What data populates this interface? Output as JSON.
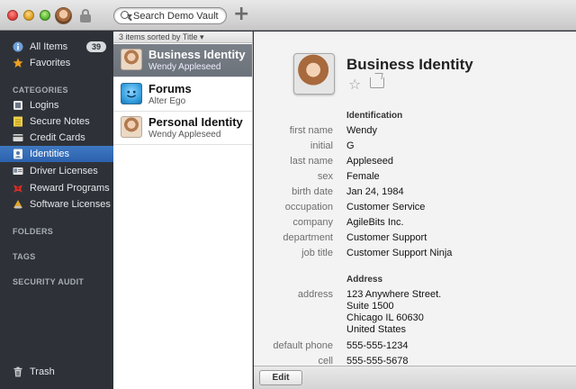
{
  "search": {
    "placeholder": "Search Demo Vault"
  },
  "sidebar": {
    "all_items": {
      "label": "All Items",
      "count": "39"
    },
    "favorites": "Favorites",
    "categories_heading": "CATEGORIES",
    "categories": [
      {
        "label": "Logins",
        "icon": "logins-icon"
      },
      {
        "label": "Secure Notes",
        "icon": "secure-notes-icon"
      },
      {
        "label": "Credit Cards",
        "icon": "credit-card-icon"
      },
      {
        "label": "Identities",
        "icon": "identity-icon",
        "selected": true
      },
      {
        "label": "Driver Licenses",
        "icon": "driver-license-icon"
      },
      {
        "label": "Reward Programs",
        "icon": "ribbon-icon"
      },
      {
        "label": "Software Licenses",
        "icon": "software-license-icon"
      }
    ],
    "folders_heading": "FOLDERS",
    "tags_heading": "TAGS",
    "security_audit_heading": "SECURITY AUDIT",
    "trash": "Trash"
  },
  "list": {
    "sort_header": "3 items sorted by Title ▾",
    "items": [
      {
        "title": "Business Identity",
        "subtitle": "Wendy Appleseed",
        "selected": true
      },
      {
        "title": "Forums",
        "subtitle": "Alter Ego"
      },
      {
        "title": "Personal Identity",
        "subtitle": "Wendy Appleseed"
      }
    ]
  },
  "detail": {
    "title": "Business Identity",
    "identification_heading": "Identification",
    "fields": [
      {
        "label": "first name",
        "value": "Wendy"
      },
      {
        "label": "initial",
        "value": "G"
      },
      {
        "label": "last name",
        "value": "Appleseed"
      },
      {
        "label": "sex",
        "value": "Female"
      },
      {
        "label": "birth date",
        "value": "Jan 24, 1984"
      },
      {
        "label": "occupation",
        "value": "Customer Service"
      },
      {
        "label": "company",
        "value": "AgileBits Inc."
      },
      {
        "label": "department",
        "value": "Customer Support"
      },
      {
        "label": "job title",
        "value": "Customer Support Ninja"
      }
    ],
    "address_heading": "Address",
    "address_label": "address",
    "address_lines": [
      "123 Anywhere Street.",
      "Suite 1500",
      "Chicago IL 60630",
      "United States"
    ],
    "phone_fields": [
      {
        "label": "default phone",
        "value": "555-555-1234"
      },
      {
        "label": "cell",
        "value": "555-555-5678"
      }
    ],
    "edit_label": "Edit"
  },
  "colors": {
    "selection_blue": "#2d62ad",
    "sidebar_bg": "#2e3238"
  }
}
